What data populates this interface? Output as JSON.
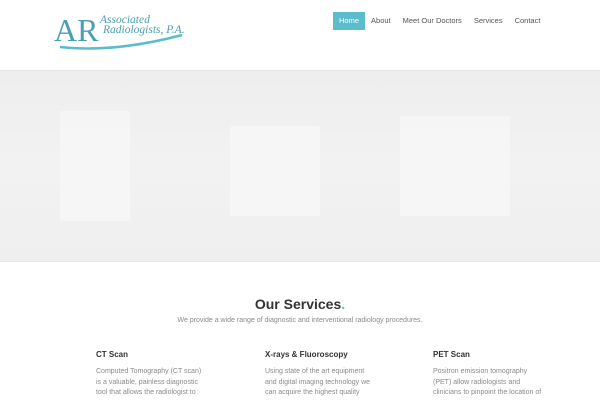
{
  "logo": {
    "monogram": "AR",
    "line1": "Associated",
    "line2": "Radiologists, P.A."
  },
  "nav": {
    "items": [
      {
        "label": "Home",
        "active": true
      },
      {
        "label": "About",
        "active": false
      },
      {
        "label": "Meet Our Doctors",
        "active": false
      },
      {
        "label": "Services",
        "active": false
      },
      {
        "label": "Contact",
        "active": false
      }
    ]
  },
  "services": {
    "title": "Our Services",
    "title_dot": ".",
    "subtitle": "We provide a wide range of diagnostic and interventional radiology procedures.",
    "items": [
      {
        "title": "CT Scan",
        "lines": [
          "Computed Tomography (CT scan)",
          "is a valuable, painless diagnostic",
          "tool that allows the radiologist to"
        ]
      },
      {
        "title": "X-rays & Fluoroscopy",
        "lines": [
          "Using state of the art equipment",
          "and digital imaging technology we",
          "can acquire the highest quality"
        ]
      },
      {
        "title": "PET Scan",
        "lines": [
          "Positron emission tomography",
          "(PET) allow radiologists and",
          "clinicians to pinpoint the location of"
        ]
      }
    ]
  },
  "colors": {
    "accent": "#5bbccc",
    "logo": "#4a9fb0"
  }
}
